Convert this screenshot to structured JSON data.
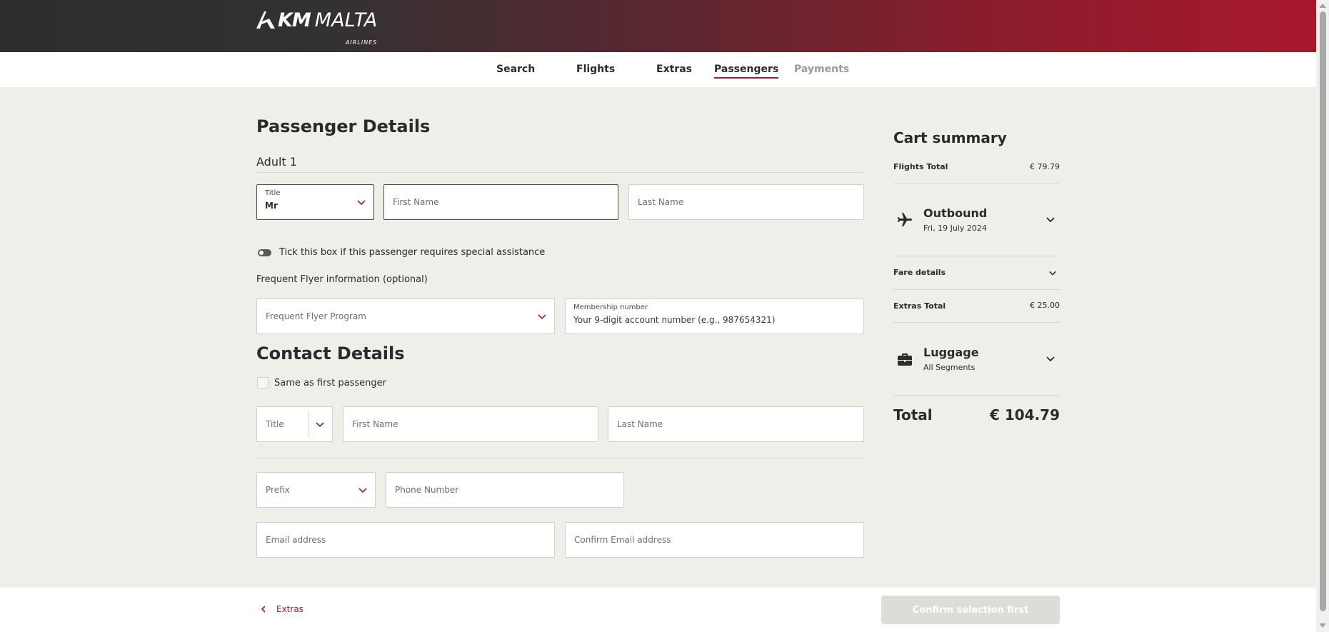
{
  "brand": {
    "logo_km": "KM",
    "logo_malta": "MALTA",
    "logo_airlines": "AIRLINES"
  },
  "steps": [
    {
      "label": "Search",
      "state": "done"
    },
    {
      "label": "Flights",
      "state": "done"
    },
    {
      "label": "Extras",
      "state": "done"
    },
    {
      "label": "Passengers",
      "state": "active"
    },
    {
      "label": "Payments",
      "state": "disabled"
    }
  ],
  "passenger": {
    "heading": "Passenger Details",
    "adult_label": "Adult 1",
    "title_label": "Title",
    "title_value": "Mr",
    "first_name_placeholder": "First Name",
    "last_name_placeholder": "Last Name",
    "assistance_text": "Tick this box if this passenger requires special assistance",
    "ff_heading": "Frequent Flyer information (optional)",
    "ff_program_placeholder": "Frequent Flyer Program",
    "membership_label": "Membership number",
    "membership_placeholder": "Your 9-digit account number (e.g., 987654321)"
  },
  "contact": {
    "heading": "Contact Details",
    "same_as_first": "Same as first passenger",
    "title_placeholder": "Title",
    "first_name_placeholder": "First Name",
    "last_name_placeholder": "Last Name",
    "prefix_placeholder": "Prefix",
    "phone_placeholder": "Phone Number",
    "email_placeholder": "Email address",
    "confirm_email_placeholder": "Confirm Email address"
  },
  "cart": {
    "title": "Cart summary",
    "flights_total_label": "Flights Total",
    "flights_total_value": "€ 79.79",
    "outbound_title": "Outbound",
    "outbound_date": "Fri, 19 July 2024",
    "fare_details_label": "Fare details",
    "extras_total_label": "Extras Total",
    "extras_total_value": "€ 25.00",
    "luggage_title": "Luggage",
    "luggage_sub": "All Segments",
    "total_label": "Total",
    "total_value": "€ 104.79"
  },
  "footer": {
    "back_label": "Extras",
    "confirm_label": "Confirm selection first"
  },
  "colors": {
    "accent": "#a8182d",
    "focus": "#2f5d3a",
    "background": "#efefea"
  },
  "icons": [
    "km-malta-logo-icon",
    "chevron-down-icon",
    "airplane-icon",
    "briefcase-icon",
    "chevron-left-icon"
  ]
}
